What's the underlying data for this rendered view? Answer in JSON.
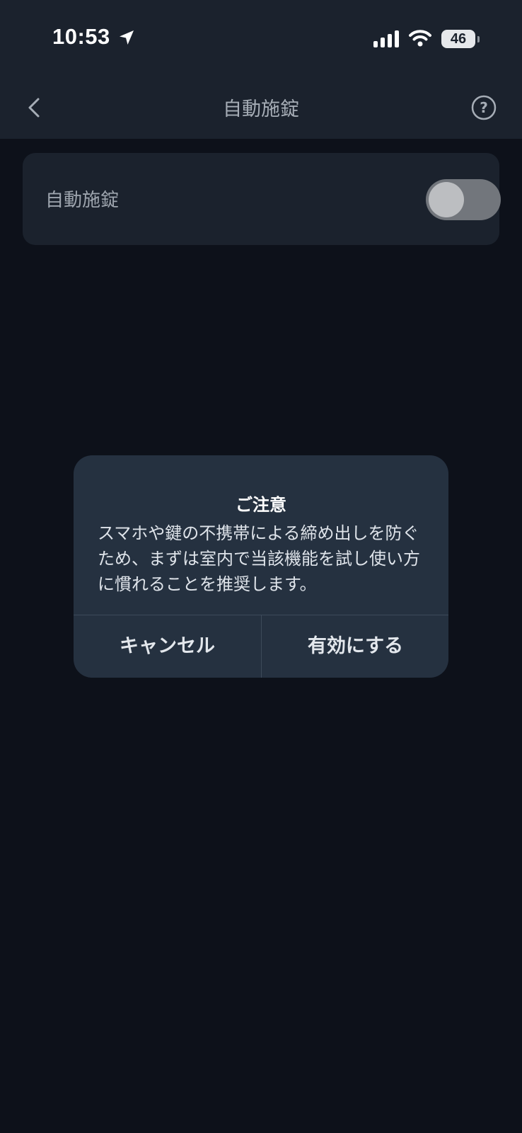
{
  "status_bar": {
    "time": "10:53",
    "battery_level": "46",
    "icons": [
      "location-arrow-icon",
      "cellular-signal-icon",
      "wifi-icon",
      "battery-icon"
    ]
  },
  "nav": {
    "title": "自動施錠",
    "back_icon": "chevron-left-icon",
    "help_icon": "question-circle-icon"
  },
  "setting": {
    "label": "自動施錠",
    "toggle_on": false
  },
  "dialog": {
    "title": "ご注意",
    "message": "スマホや鍵の不携帯による締め出しを防ぐため、まずは室内で当該機能を試し使い方に慣れることを推奨します。",
    "cancel_label": "キャンセル",
    "confirm_label": "有効にする"
  },
  "colors": {
    "header_background": "#1b222d",
    "content_background": "#0d111a",
    "card_background": "#1b222d",
    "dialog_background": "#253140",
    "toggle_off": "#72767c"
  }
}
